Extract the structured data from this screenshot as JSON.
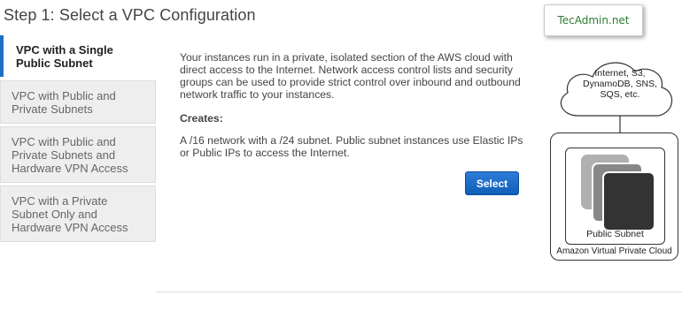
{
  "page_title": "Step 1: Select a VPC Configuration",
  "watermark": "TecAdmin.net",
  "sidebar": {
    "items": [
      {
        "label": "VPC with a Single Public Subnet",
        "active": true
      },
      {
        "label": "VPC with Public and Private Subnets",
        "active": false
      },
      {
        "label": "VPC with Public and Private Subnets and Hardware VPN Access",
        "active": false
      },
      {
        "label": "VPC with a Private Subnet Only and Hardware VPN Access",
        "active": false
      }
    ]
  },
  "content": {
    "description": "Your instances run in a private, isolated section of the AWS cloud with direct access to the Internet. Network access control lists and security groups can be used to provide strict control over inbound and outbound network traffic to your instances.",
    "creates_title": "Creates:",
    "creates_description": "A /16 network with a /24 subnet. Public subnet instances use Elastic IPs or Public IPs to access the Internet.",
    "select_label": "Select"
  },
  "diagram": {
    "cloud_line1": "Internet, S3,",
    "cloud_line2": "DynamoDB, SNS,",
    "cloud_line3": "SQS, etc.",
    "subnet_label": "Public Subnet",
    "vpc_label": "Amazon Virtual Private Cloud"
  },
  "colors": {
    "accent": "#1f6fc6",
    "button": "#1565c0",
    "sidebar_bg": "#eeeeee",
    "watermark_text": "#2e7d32"
  }
}
